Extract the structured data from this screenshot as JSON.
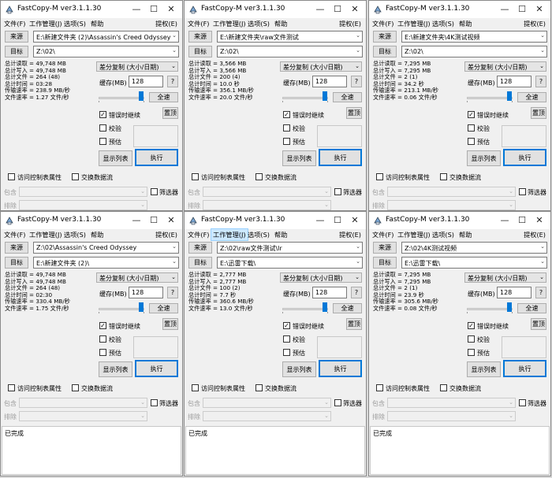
{
  "common": {
    "title": "FastCopy-M ver3.1.1.30",
    "menu": {
      "file": "文件(F)",
      "job": "工作管理(J)",
      "options": "选项(S)",
      "help": "帮助",
      "privilege": "提权(E)"
    },
    "source_btn": "来源",
    "dest_btn": "目标",
    "mode": "差分复制 (大小/日期)",
    "buffer_label": "缓存(MB)",
    "help_btn": "?",
    "full_speed": "全速",
    "verify_continue": "错误时继续",
    "verify": "校验",
    "estimate": "预估",
    "reset": "置顶",
    "show_list": "显示列表",
    "execute": "执行",
    "acl": "访问控制表属性",
    "streams": "交换数据流",
    "filter": "筛选器",
    "include": "包含",
    "exclude": "排除",
    "minimize": "—",
    "maximize": "☐",
    "close": "✕",
    "combo_arrow": "⌄"
  },
  "windows": [
    {
      "source": "E:\\新建文件夹 (2)\\Assassin's Creed Odyssey",
      "dest": "Z:\\02\\",
      "buffer": "128",
      "stats": [
        "总计读取 = 49,748 MB",
        "总计写入 = 49,748 MB",
        "总计文件 = 264 (48)",
        "总计时间 = 03:28",
        "传输速率 = 238.9 MB/秒",
        "文件速率 = 1.27 文件/秒"
      ],
      "status": ""
    },
    {
      "source": "E:\\新建文件夹\\raw文件测试",
      "dest": "Z:\\02\\",
      "buffer": "128",
      "stats": [
        "总计读取 = 3,566 MB",
        "总计写入 = 3,566 MB",
        "总计文件 = 200 (4)",
        "总计时间 = 10.0 秒",
        "传输速率 = 356.1 MB/秒",
        "文件速率 = 20.0 文件/秒"
      ],
      "status": ""
    },
    {
      "source": "E:\\新建文件夹\\4K测试视频",
      "dest": "Z:\\02\\",
      "buffer": "128",
      "stats": [
        "总计读取 = 7,295 MB",
        "总计写入 = 7,295 MB",
        "总计文件 = 2 (1)",
        "总计时间 = 34.2 秒",
        "传输速率 = 213.1 MB/秒",
        "文件速率 = 0.06 文件/秒"
      ],
      "status": ""
    },
    {
      "source": "Z:\\02\\Assassin's Creed Odyssey",
      "dest": "E:\\新建文件夹 (2)\\",
      "buffer": "128",
      "stats": [
        "总计读取 = 49,748 MB",
        "总计写入 = 49,748 MB",
        "总计文件 = 264 (48)",
        "总计时间 = 02:30",
        "传输速率 = 330.4 MB/秒",
        "文件速率 = 1.75 文件/秒"
      ],
      "status": "已完成"
    },
    {
      "source": "Z:\\02\\raw文件测试\\lr",
      "dest": "E:\\迅雷下载\\",
      "buffer": "128",
      "stats": [
        "总计读取 = 2,777 MB",
        "总计写入 = 2,777 MB",
        "总计文件 = 100 (2)",
        "总计时间 = 7.7 秒",
        "传输速率 = 360.6 MB/秒",
        "文件速率 = 13.0 文件/秒"
      ],
      "status": "已完成"
    },
    {
      "source": "Z:\\02\\4K测试视频",
      "dest": "E:\\迅雷下载\\",
      "buffer": "128",
      "stats": [
        "总计读取 = 7,295 MB",
        "总计写入 = 7,295 MB",
        "总计文件 = 2 (1)",
        "总计时间 = 23.9 秒",
        "传输速率 = 305.6 MB/秒",
        "文件速率 = 0.08 文件/秒"
      ],
      "status": "已完成"
    }
  ]
}
